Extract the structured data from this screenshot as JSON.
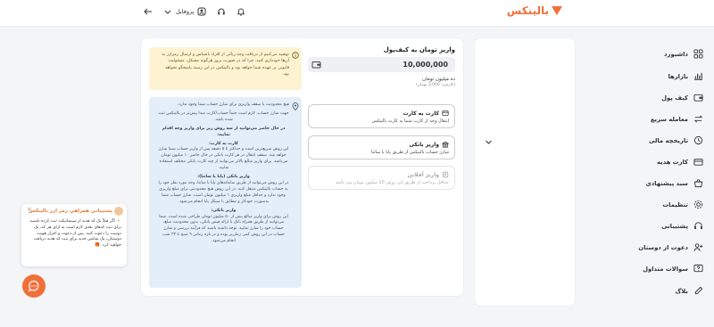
{
  "brand": {
    "name": "بالینکس",
    "accent": "#f26f3a"
  },
  "header": {
    "profile_label": "پروفایل",
    "icons": [
      "bell-icon",
      "headset-icon",
      "user-icon",
      "chevron-down-icon",
      "arrow-left-icon"
    ]
  },
  "sidebar": {
    "items": [
      {
        "label": "داشبورد",
        "icon": "dashboard-icon"
      },
      {
        "label": "بازارها",
        "icon": "markets-icon"
      },
      {
        "label": "کیف پول",
        "icon": "wallet-icon"
      },
      {
        "label": "معامله سریع",
        "icon": "swap-icon"
      },
      {
        "label": "تاریخچه مالی",
        "icon": "history-icon"
      },
      {
        "label": "کارت هدیه",
        "icon": "gift-icon"
      },
      {
        "label": "سبد پیشنهادی",
        "icon": "basket-icon"
      },
      {
        "label": "تنظیمات",
        "icon": "settings-icon"
      },
      {
        "label": "پشتیبانی",
        "icon": "support-icon"
      },
      {
        "label": "دعوت از دوستان",
        "icon": "invite-icon"
      },
      {
        "label": "سوالات متداول",
        "icon": "faq-icon"
      },
      {
        "label": "بلاگ",
        "icon": "blog-icon"
      }
    ]
  },
  "deposit": {
    "title": "واریز تومان به کیف‌پول",
    "amount": "10,000,000",
    "amount_words": "ده میلیون تومان",
    "amount_sub": "(کارمزد: 3,000 تومان)",
    "options": [
      {
        "title": "کارت به کارت",
        "desc": "انتقال وجه از کارت شما به کارت بالینکس",
        "icon": "card-icon",
        "enabled": true
      },
      {
        "title": "واریز بانکی",
        "desc": "شارژ حساب بالینکس از طریق پایا یا ساتنا",
        "icon": "bank-icon",
        "enabled": true
      },
      {
        "title": "واریز آفلاین",
        "desc": "حداقل پرداخت از طریق این روش 10 میلیون تومان می باشد",
        "icon": "offline-icon",
        "enabled": false
      }
    ]
  },
  "warning": {
    "text": "توصیه می‌کنیم از دریافت وجه ریالی از افراد ناشناس و ارسال رمزارز به آن‌ها خودداری کنید، چرا که در صورت بروز هرگونه مشکل، مسئولیت قانونی بر عهده شما خواهد بود و بالینکس در این زمینه پاسخگو نخواهد بود."
  },
  "info": {
    "paragraphs": [
      {
        "text": "هیچ محدودیت یا سقف واریزی برای شارژ حساب شما وجود ندارد.",
        "heading": false
      },
      {
        "text": "جهت شارژ حساب، لازم است حتماً حساب/کارت مبدا پیش‌تر در بالینکس ثبت شده باشد.",
        "heading": false
      },
      {
        "text": "در حال حاضر می‌توانید از سه روش زیر برای واریز وجه اقدام نمایید:",
        "heading": true
      },
      {
        "text": "کارت به کارت:",
        "heading": true
      },
      {
        "text": "این روش سریع‌ترین است و حداکثر تا ۵ دقیقه پس از واریز حساب شما شارژ خواهد شد. سقف انتقال در هر کارت بانکی در حال حاضر ۱۰ میلیون تومان می‌باشد. برای واریز مبالغ بالاتر می‌توانید از چند کارت بانکی مختلف استفاده نمایید.",
        "heading": false
      },
      {
        "text": "واریز بانکی (پایا یا ساتنا):",
        "heading": true
      },
      {
        "text": "در این روش می‌توانید از طریق سامانه‌های پایا یا ساتنا، وجه مورد نظر خود را به حساب بالینکس منتقل کنید. در این روش هیچ محدودیتی برای مبلغ واریزی وجود ندارد و حداقل مبلغ واریزی ۱ میلیون تومان است. شارژ حساب شما به‌صورت خودکار و مطابق با سیکل پایا انجام می‌شود.",
        "heading": false
      },
      {
        "text": "واریز بانکی:",
        "heading": true
      },
      {
        "text": "این روش برای واریز مبالغ بیش از ۵۰ میلیون تومان طراحی شده است. شما می‌توانید از طریق همراه بانک یا ارائه فیش بانکی، بدون محدودیت مبلغ، حساب خود را شارژ نمایید. توجه داشته باشید که فرآیند بررسی و شارژ حساب در این روش کمی زمان‌بر بوده و در بازه زمانی ۹ صبح تا ۲۳ شب انجام می‌شود.",
        "heading": false
      }
    ]
  },
  "notification": {
    "title": "پشتیبانی همراهی رمز ارز بالینکس",
    "body": "🔸 اگر قبلاً یک کد هدیه از سینمانیکت ثبت کرده باشید، برای ثبت کدهای بعدی لازم است به ازای هر کد، یک دوست را دعوت کنید. پس از دعوت و احراز هویت دوستتان، یک شانس جدید برای ثبت کد هدیه دریافت خواهید کرد. 🎁"
  }
}
